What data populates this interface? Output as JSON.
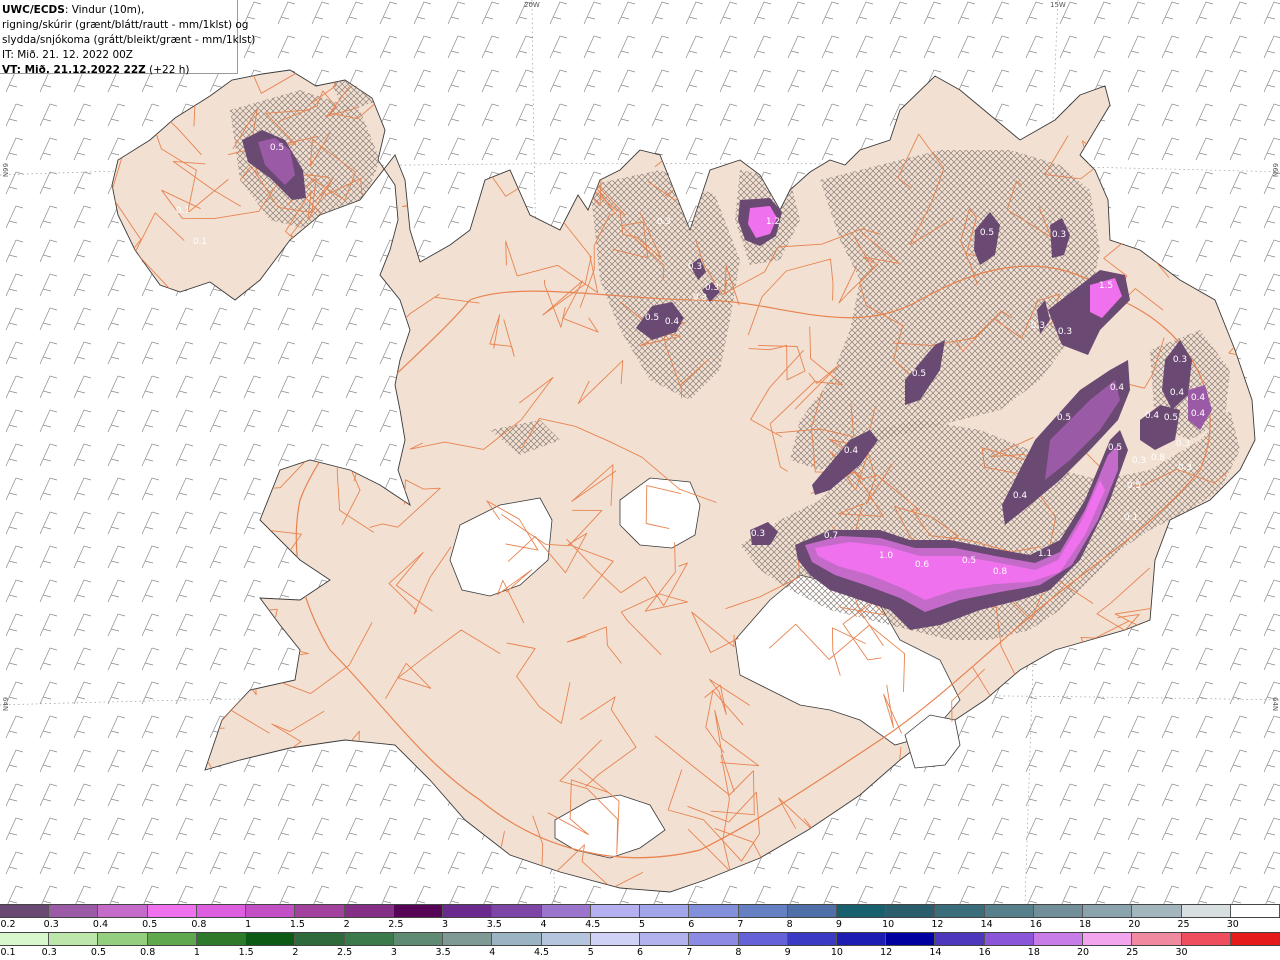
{
  "header": {
    "line1_bold": "UWC/ECDS",
    "line1_rest": ": Vindur (10m),",
    "line2": "rigning/skúrir (grænt/blátt/rautt - mm/1klst) og",
    "line3": "slydda/snjókoma (grátt/bleikt/grænt - mm/1klst)",
    "line4": "IT: Mið. 21. 12. 2022 00Z",
    "line5_bold": "VT: Mið. 21.12.2022 22Z",
    "line5_rest": " (+22 h)"
  },
  "graticule": {
    "lon_top": [
      "20W",
      "15W"
    ],
    "lat_side": [
      "66N",
      "64N"
    ]
  },
  "precip_labels": [
    "0.5",
    "0.1",
    "0.1",
    "0.3",
    "1.2",
    "0.5",
    "0.3",
    "0.3",
    "0.3",
    "0.3",
    "0.5",
    "0.4",
    "0.3",
    "0.3",
    "0.5",
    "1.5",
    "0.3",
    "0.4",
    "0.5",
    "0.4",
    "0.4",
    "0.5",
    "0.4",
    "0.4",
    "0.5",
    "0.8",
    "0.3",
    "0.3",
    "0.5",
    "0.3",
    "0.4",
    "0.1",
    "0.4",
    "0.3",
    "0.7",
    "1.0",
    "0.6",
    "0.5",
    "0.8",
    "1.1"
  ],
  "legend_top": {
    "title": "slydda/snjókoma",
    "values": [
      "0.2",
      "0.3",
      "0.4",
      "0.5",
      "0.8",
      "1",
      "1.5",
      "2",
      "2.5",
      "3",
      "3.5",
      "4",
      "4.5",
      "5",
      "6",
      "7",
      "8",
      "9",
      "10",
      "12",
      "14",
      "16",
      "18",
      "20",
      "25",
      "30"
    ],
    "colors": [
      "#6a4a72",
      "#9b5aa5",
      "#c46bc9",
      "#f071ed",
      "#de5ee0",
      "#c24fc4",
      "#a3419f",
      "#842e86",
      "#560455",
      "#6a2a8e",
      "#7d46a6",
      "#9b75cc",
      "#b5b1f0",
      "#a0a6e9",
      "#8290db",
      "#6580c3",
      "#4e6fa8",
      "#18606e",
      "#2a5e6d",
      "#3b6e7b",
      "#56818c",
      "#718f99",
      "#8aa3ad",
      "#a4b6bd",
      "#d8dfe1",
      "#ffffff"
    ]
  },
  "legend_bottom": {
    "title": "rigning/skúrir",
    "values": [
      "0.1",
      "0.3",
      "0.5",
      "0.8",
      "1",
      "1.5",
      "2",
      "2.5",
      "3",
      "3.5",
      "4",
      "4.5",
      "5",
      "6",
      "7",
      "8",
      "9",
      "10",
      "12",
      "14",
      "16",
      "18",
      "20",
      "25",
      "30"
    ],
    "colors": [
      "#d9f7cc",
      "#bde6aa",
      "#93cf7f",
      "#5fa84d",
      "#2e7a2b",
      "#0c5a14",
      "#2f6a3a",
      "#3c7a4c",
      "#5e8b72",
      "#7f9a94",
      "#9bb4c4",
      "#b6c5de",
      "#cfd2f4",
      "#b2b2ee",
      "#8d8ae3",
      "#6462d6",
      "#3a3ac4",
      "#1d1db3",
      "#0000a0",
      "#4e37bc",
      "#8a55d8",
      "#c77ce8",
      "#f2a4ec",
      "#f08aa0",
      "#ee4e5d",
      "#e51b1b"
    ]
  }
}
